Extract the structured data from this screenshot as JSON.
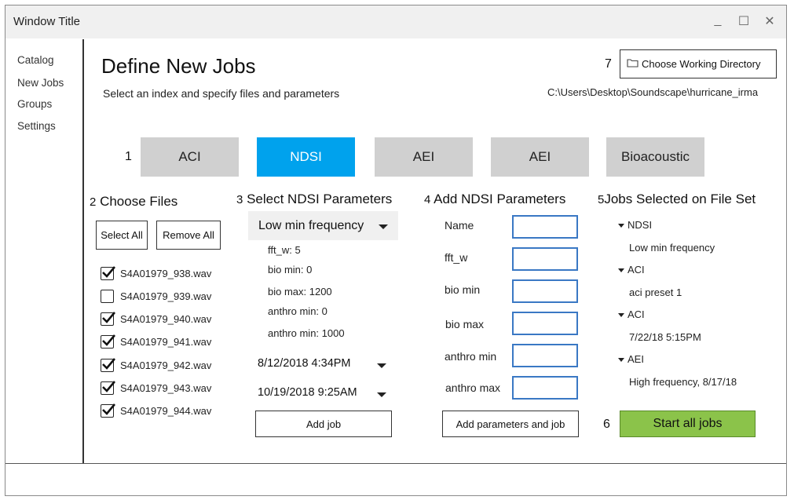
{
  "window": {
    "title": "Window Title",
    "controls": {
      "minimize": "_",
      "maximize": "☐",
      "close": "✕"
    }
  },
  "sidebar": {
    "items": [
      {
        "label": "Catalog"
      },
      {
        "label": "New Jobs"
      },
      {
        "label": "Groups"
      },
      {
        "label": "Settings"
      }
    ]
  },
  "header": {
    "title": "Define New Jobs",
    "subtitle": "Select an index and specify files and parameters",
    "working_dir_button": "Choose Working Directory",
    "working_dir_path": "C:\\Users\\Desktop\\Soundscape\\hurricane_irma"
  },
  "markers": {
    "tabs": "1",
    "files": "2",
    "select_params": "3",
    "add_params": "4",
    "jobs": "5",
    "start": "6",
    "working_dir": "7"
  },
  "tabs": [
    {
      "label": "ACI",
      "active": false
    },
    {
      "label": "NDSI",
      "active": true
    },
    {
      "label": "AEI",
      "active": false
    },
    {
      "label": "AEI",
      "active": false
    },
    {
      "label": "Bioacoustic",
      "active": false
    }
  ],
  "files": {
    "heading": "Choose Files",
    "select_all": "Select All",
    "remove_all": "Remove All",
    "items": [
      {
        "name": "S4A01979_938.wav",
        "checked": true
      },
      {
        "name": "S4A01979_939.wav",
        "checked": false
      },
      {
        "name": "S4A01979_940.wav",
        "checked": true
      },
      {
        "name": "S4A01979_941.wav",
        "checked": true
      },
      {
        "name": "S4A01979_942.wav",
        "checked": true
      },
      {
        "name": "S4A01979_943.wav",
        "checked": true
      },
      {
        "name": "S4A01979_944.wav",
        "checked": true
      }
    ]
  },
  "select_params": {
    "heading": "Select NDSI Parameters",
    "preset": "Low min frequency",
    "details": [
      "fft_w: 5",
      "bio min: 0",
      "bio max: 1200",
      "anthro min: 0",
      "anthro min: 1000"
    ],
    "start_date": "8/12/2018 4:34PM",
    "end_date": "10/19/2018 9:25AM",
    "add_job": "Add job"
  },
  "add_params": {
    "heading": "Add NDSI Parameters",
    "fields": [
      {
        "label": "Name",
        "value": ""
      },
      {
        "label": "fft_w",
        "value": ""
      },
      {
        "label": "bio min",
        "value": ""
      },
      {
        "label": "bio max",
        "value": ""
      },
      {
        "label": "anthro min",
        "value": ""
      },
      {
        "label": "anthro max",
        "value": ""
      }
    ],
    "submit": "Add parameters and job"
  },
  "jobs": {
    "heading": "Jobs Selected on File Set",
    "groups": [
      {
        "index": "NDSI",
        "detail": "Low min frequency"
      },
      {
        "index": "ACI",
        "detail": "aci preset 1"
      },
      {
        "index": "ACI",
        "detail": "7/22/18 5:15PM"
      },
      {
        "index": "AEI",
        "detail": "High frequency, 8/17/18"
      }
    ],
    "start_all": "Start all jobs"
  },
  "colors": {
    "accent": "#00a2ed",
    "tab_inactive": "#d0d0d0",
    "start_button": "#8bc34a",
    "input_border": "#3a78c4"
  }
}
